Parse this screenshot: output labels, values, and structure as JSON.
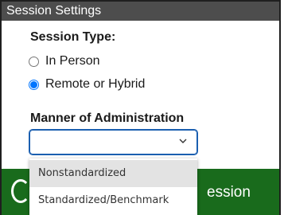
{
  "panel": {
    "title": "Session Settings"
  },
  "session_type": {
    "label": "Session Type:",
    "options": [
      {
        "label": "In Person",
        "checked": false
      },
      {
        "label": "Remote or Hybrid",
        "checked": true
      }
    ]
  },
  "manner": {
    "label": "Manner of Administration",
    "selected_value": "",
    "options": [
      {
        "label": "Nonstandardized",
        "highlighted": true
      },
      {
        "label": "Standardized/Benchmark",
        "highlighted": false
      }
    ]
  },
  "action_button": {
    "visible_text": "ession"
  },
  "colors": {
    "titlebar": "#4d4d4d",
    "accent": "#0075ff",
    "button_green": "#196b1c",
    "select_border": "#1b5fb0"
  },
  "icons": {
    "select_arrow": "chevron-down-icon"
  }
}
